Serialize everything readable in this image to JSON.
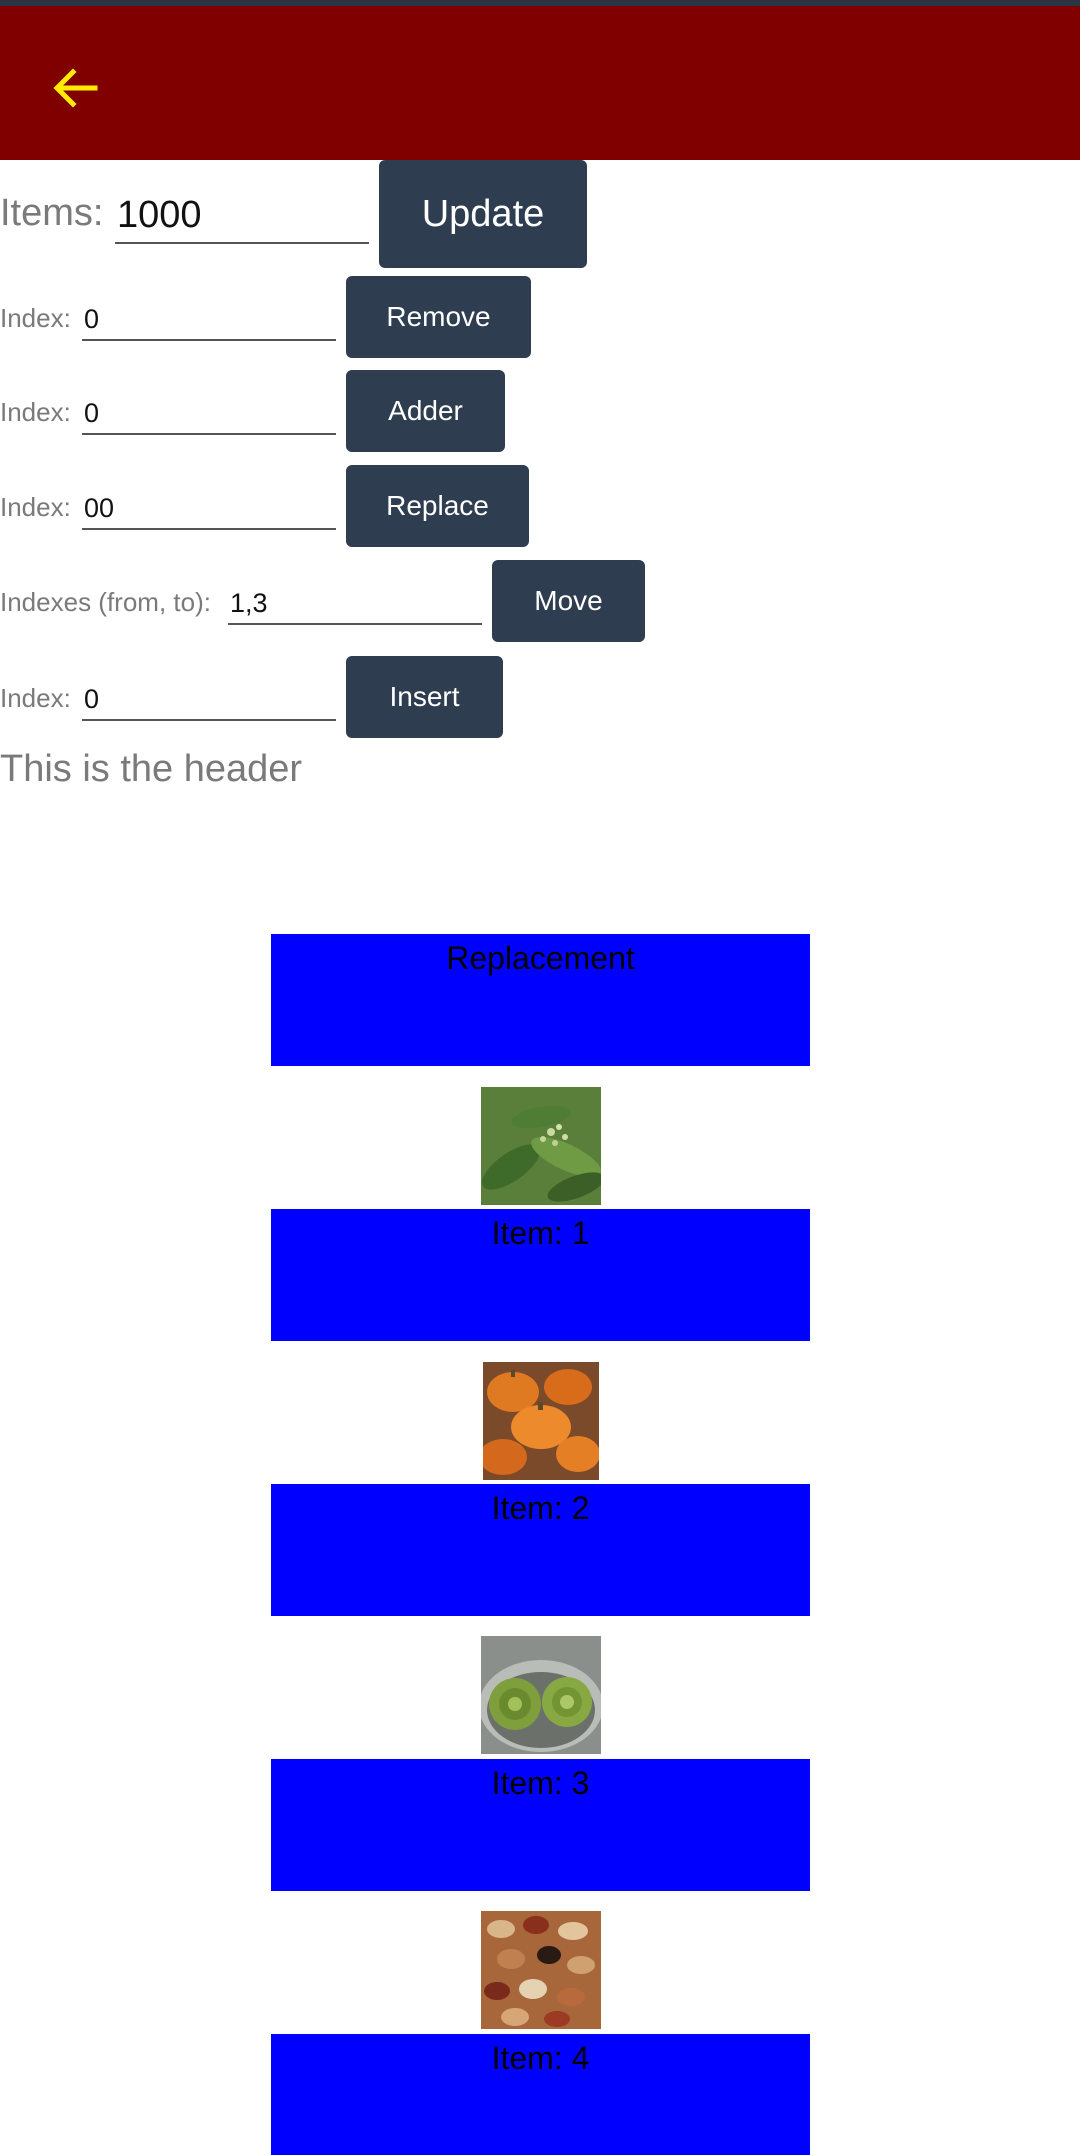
{
  "appbar": {
    "back_icon": "arrow-left-icon",
    "icon_color": "#ffeb00",
    "background": "#800000"
  },
  "controls": {
    "items": {
      "label": "Items:",
      "value": "1000",
      "button": "Update"
    },
    "remove": {
      "label": "Index:",
      "value": "0",
      "button": "Remove"
    },
    "adder": {
      "label": "Index:",
      "value": "0",
      "button": "Adder"
    },
    "replace": {
      "label": "Index:",
      "value": "00",
      "button": "Replace"
    },
    "move": {
      "label": "Indexes (from, to):",
      "value": "1,3",
      "button": "Move"
    },
    "insert": {
      "label": "Index:",
      "value": "0",
      "button": "Insert"
    }
  },
  "list": {
    "header": "This is the header",
    "items": [
      {
        "label": "Replacement"
      },
      {
        "label": "Item: 1",
        "image": "herb-plant-photo"
      },
      {
        "label": "Item: 2",
        "image": "pumpkins-photo"
      },
      {
        "label": "Item: 3",
        "image": "artichokes-photo"
      },
      {
        "label": "Item: 4",
        "image": "beans-photo"
      }
    ]
  }
}
